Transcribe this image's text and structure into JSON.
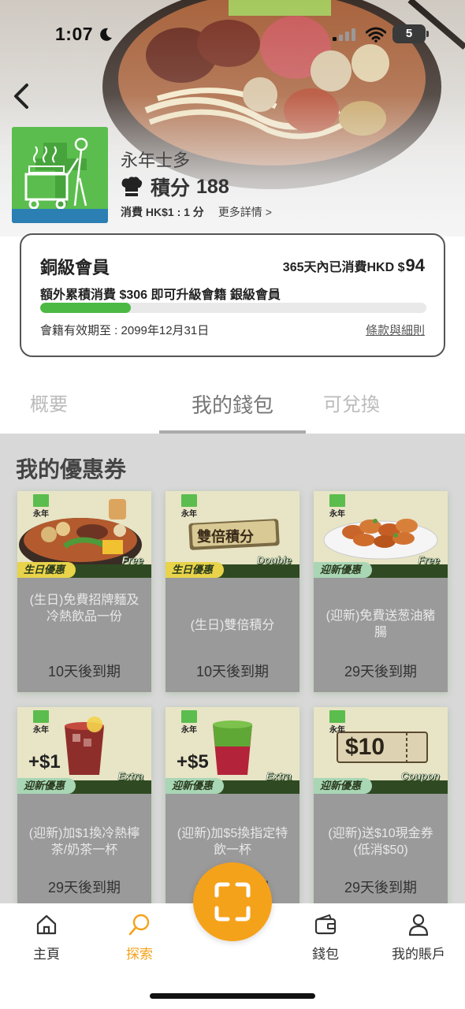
{
  "status_bar": {
    "time": "1:07",
    "battery_level": "5"
  },
  "merchant": {
    "name": "永年士多",
    "points_label": "積分",
    "points_value": "188",
    "rate_text": "消費 HK$1 : 1 分",
    "more_details": "更多詳情 >"
  },
  "membership": {
    "tier": "銅級會員",
    "spent_label": "365天內已消費HKD $",
    "spent_amount": "94",
    "upgrade_text": "額外累積消費 $306 即可升級會籍 銀級會員",
    "progress_fraction": 0.235,
    "expiry_text": "會籍有效期至 : 2099年12月31日",
    "terms_link": "條款與細則"
  },
  "tabs": [
    {
      "label": "概要",
      "active": false
    },
    {
      "label": "我的錢包",
      "active": true
    },
    {
      "label": "可兌換",
      "active": false
    }
  ],
  "section_title": "我的優惠券",
  "coupons": [
    {
      "tag": "生日優惠",
      "corner": "Free",
      "art_text": "",
      "title": "(生日)免費招牌麵及冷熱飲品一份",
      "expiry": "10天後到期"
    },
    {
      "tag": "生日優惠",
      "corner": "Double",
      "art_text": "雙倍積分",
      "title": "(生日)雙倍積分",
      "expiry": "10天後到期"
    },
    {
      "tag": "迎新優惠",
      "corner": "Free",
      "art_text": "",
      "title": "(迎新)免費送葱油豬腸",
      "expiry": "29天後到期"
    },
    {
      "tag": "迎新優惠",
      "corner": "Extra",
      "art_text": "+$1",
      "title": "(迎新)加$1換冷熱檸茶/奶茶一杯",
      "expiry": "29天後到期"
    },
    {
      "tag": "迎新優惠",
      "corner": "Extra",
      "art_text": "+$5",
      "title": "(迎新)加$5換指定特飲一杯",
      "expiry": "29天後到期"
    },
    {
      "tag": "迎新優惠",
      "corner": "Coupon",
      "art_text": "$10",
      "title": "(迎新)送$10現金券(低消$50)",
      "expiry": "29天後到期"
    }
  ],
  "bottom_nav": {
    "home": "主頁",
    "explore": "探索",
    "wallet": "錢包",
    "account": "我的賬戶"
  },
  "colors": {
    "accent_orange": "#f5a21b",
    "brand_green": "#5bbd4d",
    "progress_green": "#4cb944",
    "tag_yellow": "#e8d34a",
    "tag_green": "#a9d6b5"
  }
}
